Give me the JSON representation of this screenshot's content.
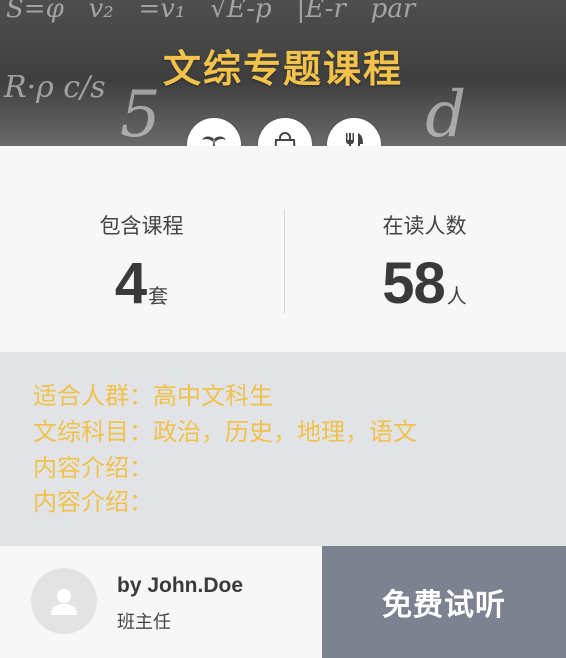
{
  "banner": {
    "title": "文综专题课程",
    "icons": [
      "palm-tree-icon",
      "shopping-bag-icon",
      "fork-knife-icon"
    ]
  },
  "stats": {
    "courses": {
      "label": "包含课程",
      "value": "4",
      "unit": "套"
    },
    "readers": {
      "label": "在读人数",
      "value": "58",
      "unit": "人"
    }
  },
  "info": {
    "audience": "适合人群：高中文科生",
    "subjects": "文综科目：政治，历史，地理，语文",
    "content1": "内容介绍：",
    "content2": "内容介绍："
  },
  "teacher": {
    "name": "by John.Doe",
    "role": "班主任"
  },
  "cta": {
    "label": "免费试听"
  },
  "colors": {
    "accent": "#f2c24a",
    "cta_bg": "#7d8290",
    "info_bg": "#e2e3e6"
  }
}
